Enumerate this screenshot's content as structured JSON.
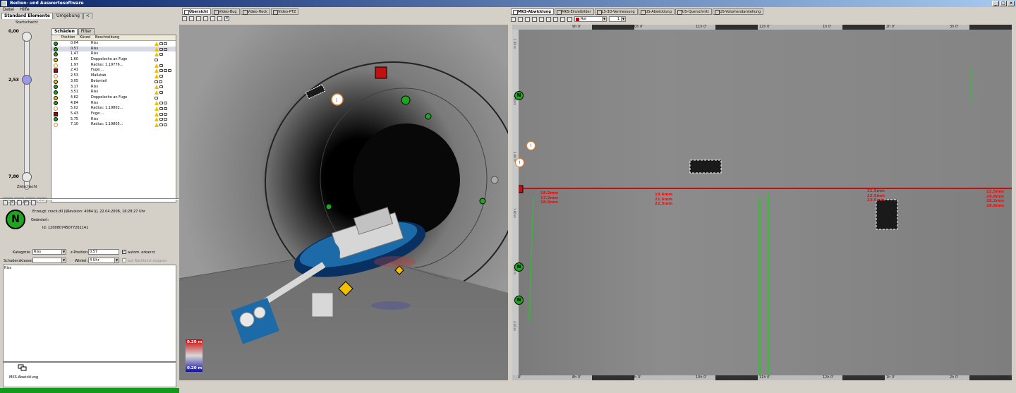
{
  "window": {
    "title": "Bedien- und Auswertesoftware",
    "controls": [
      "_",
      "□",
      "×"
    ]
  },
  "menu": [
    "Datei",
    "Hilfe"
  ],
  "left_tabs": {
    "items": [
      "Standard Elemente",
      "Umgebung",
      "<"
    ],
    "active": 0
  },
  "slider": {
    "start_label": "Startschacht",
    "top_value": "0,00",
    "current_value": "2,53",
    "bottom_value": "7,80",
    "end_label": "Zielschacht",
    "nav": [
      "<<",
      "<",
      ">",
      ">>"
    ],
    "start": 0,
    "end": 7.8,
    "current": 2.53
  },
  "damage_tabs": {
    "items": [
      "Schäden",
      "Filter"
    ],
    "active": 0
  },
  "damage_table": {
    "columns": [
      "Position",
      "Kürzel",
      "Beschreibung"
    ],
    "rows": [
      {
        "pos": "0,04",
        "desc": "Riss",
        "marker": "green",
        "icons": [
          "tri",
          "cam",
          "cam"
        ]
      },
      {
        "pos": "0,57",
        "desc": "Riss",
        "marker": "green",
        "icons": [
          "tri",
          "cam",
          "cam"
        ],
        "selected": true
      },
      {
        "pos": "1,47",
        "desc": "Riss",
        "marker": "green",
        "icons": [
          "tri",
          "cam"
        ]
      },
      {
        "pos": "1,60",
        "desc": "Doppelecho an Fuge",
        "marker": "orange",
        "icons": [
          "cam"
        ]
      },
      {
        "pos": "1,97",
        "desc": "Radius: 1.19776...",
        "marker": "info",
        "icons": [
          "tri",
          "cam"
        ]
      },
      {
        "pos": "2,41",
        "desc": "Fuge:...",
        "marker": "red",
        "icons": [
          "tri",
          "cam",
          "cam",
          "cam"
        ]
      },
      {
        "pos": "2,53",
        "desc": "Maßstab",
        "marker": "info",
        "icons": [
          "tri",
          "cam"
        ]
      },
      {
        "pos": "3,05",
        "desc": "Betonteil",
        "marker": "orange",
        "icons": [
          "cam",
          "cam"
        ]
      },
      {
        "pos": "3,17",
        "desc": "Riss",
        "marker": "green",
        "icons": [
          "tri",
          "cam"
        ]
      },
      {
        "pos": "3,51",
        "desc": "Riss",
        "marker": "green",
        "icons": [
          "tri",
          "cam"
        ]
      },
      {
        "pos": "4,62",
        "desc": "Doppelecho an Fuge",
        "marker": "orange",
        "icons": [
          "cam"
        ]
      },
      {
        "pos": "4,84",
        "desc": "Riss",
        "marker": "green",
        "icons": [
          "tri",
          "cam",
          "cam"
        ]
      },
      {
        "pos": "5,02",
        "desc": "Radius: 1.19802...",
        "marker": "info",
        "icons": [
          "tri",
          "cam",
          "cam"
        ]
      },
      {
        "pos": "5,43",
        "desc": "Fuge:...",
        "marker": "red",
        "icons": [
          "tri",
          "cam",
          "cam"
        ]
      },
      {
        "pos": "5,75",
        "desc": "Riss",
        "marker": "green",
        "icons": [
          "tri",
          "cam",
          "cam"
        ]
      },
      {
        "pos": "7,10",
        "desc": "Radius: 1.19805...",
        "marker": "info",
        "icons": [
          "tri",
          "cam",
          "cam"
        ]
      }
    ]
  },
  "detail": {
    "created_label": "Erzeugt:",
    "created_value": "crack.dll (§Revision: 4084 §), 22.04.2008, 16:28:27 Uhr",
    "changed_label": "Geändert:",
    "id_label": "Id:",
    "id_value": "120080745077261141",
    "category_label": "Kategorie:",
    "category_value": "Riss",
    "zpos_label": "z-Position:",
    "zpos_value": "0,57",
    "auto_label": "autom. erkannt",
    "damage_class_label": "Schadensklasse:",
    "damage_class_value": "",
    "angle_label": "Winkel:",
    "angle_value": "4 Uhr",
    "return_label": "auf Rückfahrt stoppen",
    "memo": "Riss",
    "bottom_label": "MKS-Abwicklung",
    "marker_glyph": "N"
  },
  "video_tabs": {
    "items": [
      "Übersicht",
      "Video-Bug",
      "Video-Heck",
      "Video-PTZ"
    ],
    "active": 0
  },
  "legend": {
    "top": "0.20 m",
    "bottom": "0.20 m",
    "colors": [
      "#cc0000",
      "#1010a0"
    ]
  },
  "mks_tabs": {
    "items": [
      "MKS-Abwicklung",
      "MKS-Einzelbilder",
      "LS-3D-Vermessung",
      "US-Abwicklung",
      "US-Querschnitt",
      "US-Volumendarstellung"
    ],
    "active": 0
  },
  "mks_toolbar": {
    "color_value": "Rot",
    "line_value": "1"
  },
  "ruler": {
    "top_ticks": [
      "9h 0'",
      "10h 0'",
      "11h 0'",
      "12h 0'",
      "1h 0'",
      "2h 0'",
      "3h 0'"
    ],
    "bottom_ticks": [
      "0'",
      "8h 0'",
      "9h 0'",
      "10h 0'",
      "11h 0'",
      "12h 0'",
      "1h 0'",
      "2h 0'",
      "3h 0'"
    ],
    "side_labels": [
      "1.20 m",
      "1.40 m",
      "1.60 m",
      "1.80 m",
      "2.00 m",
      "2.20 m"
    ]
  },
  "measurements": [
    {
      "text": "18.2mm\n17.2mm\n18.6mm"
    },
    {
      "text": "19.6mm\n21.6mm\n22.5mm"
    },
    {
      "text": "21.5mm\n22.5mm\n23.0mm"
    },
    {
      "text": "22.5mm\n26.8mm\n28.2mm\n28.6mm"
    }
  ],
  "colors": {
    "accent_green": "#1fa51f",
    "red_line": "#c01010",
    "title_start": "#0a246a"
  }
}
